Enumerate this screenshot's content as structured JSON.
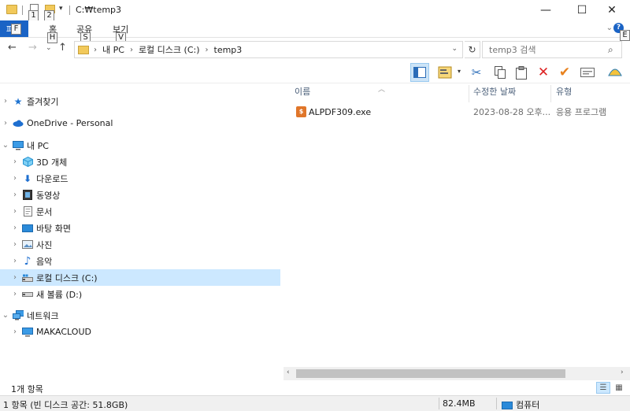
{
  "titlebar": {
    "path_title": "C:₩temp3",
    "keytips": {
      "qa1": "1",
      "qa2": "2"
    },
    "minimize": "—",
    "maximize": "☐",
    "close": "✕"
  },
  "ribbon": {
    "file_tab": "파일",
    "file_keytip": "F",
    "tabs": [
      {
        "label": "홈",
        "keytip": "H"
      },
      {
        "label": "공유",
        "keytip": "S"
      },
      {
        "label": "보기",
        "keytip": "V"
      }
    ],
    "expand_keytip": "E",
    "help": "?"
  },
  "address": {
    "crumbs": [
      "내 PC",
      "로컬 디스크 (C:)",
      "temp3"
    ],
    "search_placeholder": "temp3 검색"
  },
  "nav_tree": [
    {
      "label": "즐겨찾기",
      "icon": "star-icon",
      "indent": 0,
      "expanded": false
    },
    {
      "label": "OneDrive - Personal",
      "icon": "cloud-icon",
      "indent": 0,
      "expanded": false
    },
    {
      "label": "내 PC",
      "icon": "computer-icon",
      "indent": 0,
      "expanded": true
    },
    {
      "label": "3D 개체",
      "icon": "cube-icon",
      "indent": 1,
      "expanded": false
    },
    {
      "label": "다운로드",
      "icon": "download-icon",
      "indent": 1,
      "expanded": false
    },
    {
      "label": "동영상",
      "icon": "video-icon",
      "indent": 1,
      "expanded": false
    },
    {
      "label": "문서",
      "icon": "document-icon",
      "indent": 1,
      "expanded": false
    },
    {
      "label": "바탕 화면",
      "icon": "desktop-icon",
      "indent": 1,
      "expanded": false
    },
    {
      "label": "사진",
      "icon": "picture-icon",
      "indent": 1,
      "expanded": false
    },
    {
      "label": "음악",
      "icon": "music-icon",
      "indent": 1,
      "expanded": false
    },
    {
      "label": "로컬 디스크 (C:)",
      "icon": "drive-icon",
      "indent": 1,
      "expanded": false,
      "selected": true
    },
    {
      "label": "새 볼륨 (D:)",
      "icon": "drive-icon",
      "indent": 1,
      "expanded": false
    },
    {
      "label": "네트워크",
      "icon": "network-icon",
      "indent": 0,
      "expanded": true
    },
    {
      "label": "MAKACLOUD",
      "icon": "computer-icon",
      "indent": 1,
      "expanded": false
    }
  ],
  "columns": {
    "name": "이름",
    "date": "수정한 날짜",
    "type": "유형"
  },
  "files": [
    {
      "name": "ALPDF309.exe",
      "date": "2023-08-28 오후...",
      "type": "응용 프로그램"
    }
  ],
  "status": {
    "item_count": "1개 항목",
    "disk_info": "1 항목 (빈 디스크 공간: 51.8GB)",
    "size": "82.4MB",
    "location": "컴퓨터"
  },
  "colors": {
    "accent": "#1a63c5",
    "selection": "#cce8ff"
  }
}
